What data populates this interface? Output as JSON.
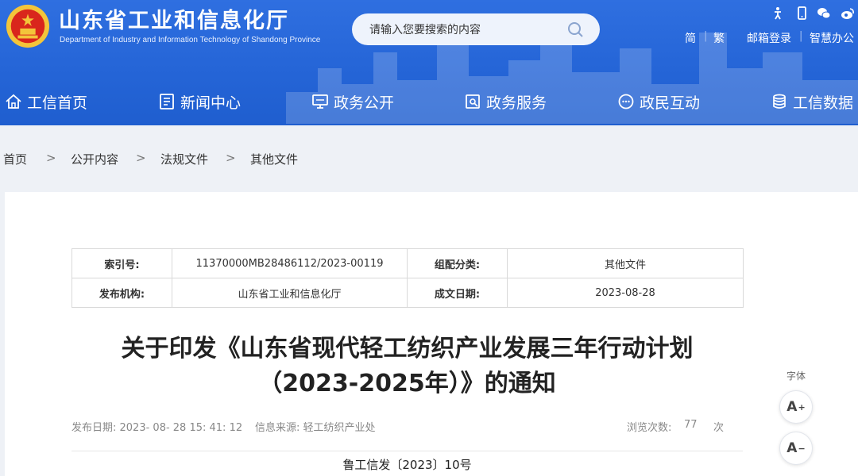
{
  "header": {
    "site_name": "山东省工业和信息化厅",
    "site_name_en": "Department of Industry and Information Technology of Shandong Province",
    "search_placeholder": "请输入您要搜索的内容",
    "icons": [
      "accessibility-icon",
      "mobile-icon",
      "wechat-icon",
      "weibo-icon"
    ],
    "links": {
      "simplified": "简",
      "sep": "|",
      "traditional": "繁",
      "mail_login": "邮箱登录",
      "smart_office": "智慧办公"
    }
  },
  "nav": [
    {
      "label": "工信首页",
      "icon": "home-icon"
    },
    {
      "label": "新闻中心",
      "icon": "news-icon"
    },
    {
      "label": "政务公开",
      "icon": "monitor-icon"
    },
    {
      "label": "政务服务",
      "icon": "service-icon"
    },
    {
      "label": "政民互动",
      "icon": "chat-icon"
    },
    {
      "label": "工信数据",
      "icon": "database-icon"
    }
  ],
  "breadcrumb": {
    "items": [
      "首页",
      "公开内容",
      "法规文件",
      "其他文件"
    ],
    "sep": ">"
  },
  "meta": {
    "index_label": "索引号:",
    "index_value": "11370000MB28486112/2023-00119",
    "category_label": "组配分类:",
    "category_value": "其他文件",
    "publisher_label": "发布机构:",
    "publisher_value": "山东省工业和信息化厅",
    "date_label": "成文日期:",
    "date_value": "2023-08-28"
  },
  "article": {
    "title_line1": "关于印发《山东省现代轻工纺织产业发展三年行动计划",
    "title_line2": "（2023-2025年）》的通知",
    "publish_date": "发布日期: 2023- 08- 28 15: 41: 12",
    "source": "信息来源: 轻工纺织产业处",
    "views_label": "浏览次数:",
    "views_count": "77",
    "views_unit": "次",
    "doc_number": "鲁工信发〔2023〕10号"
  },
  "font_tools": {
    "label": "字体",
    "increase": "A",
    "increase_sup": "+",
    "decrease": "A",
    "decrease_sup": "−"
  },
  "colors": {
    "header_blue": "#2565d7",
    "emblem_red": "#d9261c",
    "emblem_gold": "#f3c53a"
  }
}
